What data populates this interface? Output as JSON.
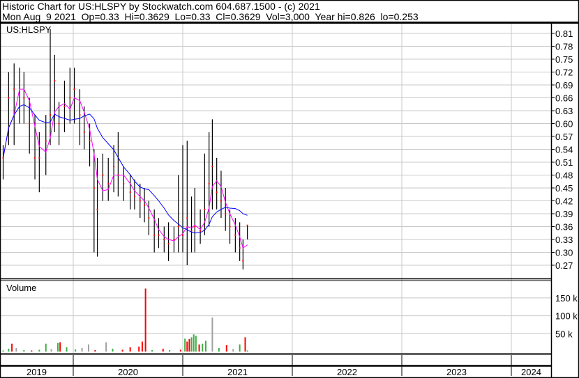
{
  "header": {
    "title": "Historic Chart for US:HLSPY by Stockwatch.com 604.687.1500 - (c) 2021",
    "quote": "Mon Aug  9 2021  Op=0.33  Hi=0.3629  Lo=0.33  Cl=0.3629  Vol=3,000  Year hi=0.826  lo=0.253"
  },
  "colors": {
    "up": "#3cb043",
    "down": "#ff0000",
    "flat": "#a0a0a0",
    "ma_short": "#ff00ff",
    "ma_long": "#0000ff",
    "grid": "#c8c8c8"
  },
  "chart_data": [
    {
      "type": "ohlc",
      "title": "US:HLSPY",
      "x_unit": "year",
      "xlim": [
        2019.33,
        2024.37
      ],
      "ylim": [
        0.245,
        0.83
      ],
      "y_ticks": [
        "0.81",
        "0.78",
        "0.75",
        "0.72",
        "0.69",
        "0.66",
        "0.63",
        "0.60",
        "0.57",
        "0.54",
        "0.51",
        "0.48",
        "0.45",
        "0.42",
        "0.39",
        "0.36",
        "0.33",
        "0.30",
        "0.27"
      ],
      "x_tick_labels": [
        "2019",
        "2020",
        "2021",
        "2022",
        "2023",
        "2024"
      ],
      "moving_averages": [
        "short",
        "long"
      ],
      "points": [
        [
          2019.36,
          0.55,
          0.47,
          0.52
        ],
        [
          2019.41,
          0.72,
          0.55,
          0.66
        ],
        [
          2019.46,
          0.74,
          0.55,
          0.68
        ],
        [
          2019.51,
          0.73,
          0.6,
          0.7
        ],
        [
          2019.55,
          0.72,
          0.6,
          0.66
        ],
        [
          2019.6,
          0.66,
          0.53,
          0.6
        ],
        [
          2019.65,
          0.62,
          0.47,
          0.52
        ],
        [
          2019.69,
          0.58,
          0.44,
          0.52
        ],
        [
          2019.75,
          0.62,
          0.48,
          0.56
        ],
        [
          2019.79,
          0.82,
          0.55,
          0.62
        ],
        [
          2019.83,
          0.76,
          0.58,
          0.7
        ],
        [
          2019.87,
          0.65,
          0.55,
          0.6
        ],
        [
          2019.92,
          0.7,
          0.58,
          0.64
        ],
        [
          2019.97,
          0.73,
          0.6,
          0.66
        ],
        [
          2020.01,
          0.73,
          0.6,
          0.68
        ],
        [
          2020.06,
          0.68,
          0.55,
          0.62
        ],
        [
          2020.1,
          0.64,
          0.54,
          0.58
        ],
        [
          2020.15,
          0.6,
          0.5,
          0.56
        ],
        [
          2020.19,
          0.54,
          0.3,
          0.45
        ],
        [
          2020.22,
          0.52,
          0.29,
          0.4
        ],
        [
          2020.27,
          0.53,
          0.42,
          0.48
        ],
        [
          2020.32,
          0.52,
          0.42,
          0.46
        ],
        [
          2020.37,
          0.55,
          0.44,
          0.5
        ],
        [
          2020.41,
          0.58,
          0.43,
          0.48
        ],
        [
          2020.46,
          0.5,
          0.42,
          0.46
        ],
        [
          2020.52,
          0.48,
          0.4,
          0.44
        ],
        [
          2020.56,
          0.47,
          0.4,
          0.43
        ],
        [
          2020.61,
          0.46,
          0.38,
          0.42
        ],
        [
          2020.65,
          0.45,
          0.37,
          0.41
        ],
        [
          2020.69,
          0.42,
          0.34,
          0.38
        ],
        [
          2020.74,
          0.4,
          0.3,
          0.34
        ],
        [
          2020.78,
          0.38,
          0.31,
          0.34
        ],
        [
          2020.83,
          0.36,
          0.3,
          0.33
        ],
        [
          2020.87,
          0.37,
          0.28,
          0.32
        ],
        [
          2020.92,
          0.36,
          0.3,
          0.33
        ],
        [
          2020.96,
          0.48,
          0.3,
          0.36
        ],
        [
          2021.0,
          0.55,
          0.3,
          0.34
        ],
        [
          2021.04,
          0.56,
          0.27,
          0.38
        ],
        [
          2021.08,
          0.43,
          0.3,
          0.35
        ],
        [
          2021.11,
          0.45,
          0.3,
          0.36
        ],
        [
          2021.16,
          0.4,
          0.32,
          0.35
        ],
        [
          2021.2,
          0.53,
          0.34,
          0.4
        ],
        [
          2021.24,
          0.58,
          0.36,
          0.46
        ],
        [
          2021.27,
          0.61,
          0.4,
          0.5
        ],
        [
          2021.31,
          0.52,
          0.4,
          0.44
        ],
        [
          2021.35,
          0.49,
          0.38,
          0.42
        ],
        [
          2021.39,
          0.45,
          0.35,
          0.39
        ],
        [
          2021.43,
          0.4,
          0.32,
          0.36
        ],
        [
          2021.48,
          0.38,
          0.3,
          0.34
        ],
        [
          2021.52,
          0.37,
          0.28,
          0.31
        ],
        [
          2021.55,
          0.33,
          0.26,
          0.28
        ],
        [
          2021.59,
          0.3629,
          0.33,
          0.3629
        ]
      ]
    },
    {
      "type": "bar",
      "title": "Volume",
      "y_unit": "k shares",
      "ylim": [
        0,
        200
      ],
      "y_ticks": [
        "150 k",
        "100 k",
        "50 k"
      ],
      "bars": [
        [
          2019.36,
          3,
          "up"
        ],
        [
          2019.41,
          8,
          "up"
        ],
        [
          2019.44,
          22,
          "down"
        ],
        [
          2019.48,
          10,
          "flat"
        ],
        [
          2019.55,
          4,
          "up"
        ],
        [
          2019.62,
          3,
          "down"
        ],
        [
          2019.69,
          5,
          "up"
        ],
        [
          2019.75,
          22,
          "up"
        ],
        [
          2019.8,
          7,
          "flat"
        ],
        [
          2019.86,
          24,
          "up"
        ],
        [
          2019.88,
          26,
          "down"
        ],
        [
          2019.94,
          12,
          "up"
        ],
        [
          2020.02,
          6,
          "up"
        ],
        [
          2020.08,
          10,
          "flat"
        ],
        [
          2020.14,
          20,
          "flat"
        ],
        [
          2020.2,
          4,
          "down"
        ],
        [
          2020.3,
          26,
          "flat"
        ],
        [
          2020.36,
          8,
          "up"
        ],
        [
          2020.45,
          5,
          "down"
        ],
        [
          2020.52,
          12,
          "down"
        ],
        [
          2020.6,
          14,
          "down"
        ],
        [
          2020.63,
          28,
          "down"
        ],
        [
          2020.66,
          176,
          "down"
        ],
        [
          2020.72,
          4,
          "up"
        ],
        [
          2020.82,
          8,
          "down"
        ],
        [
          2020.88,
          4,
          "up"
        ],
        [
          2020.98,
          5,
          "down"
        ],
        [
          2021.02,
          36,
          "up"
        ],
        [
          2021.04,
          28,
          "down"
        ],
        [
          2021.06,
          35,
          "down"
        ],
        [
          2021.08,
          40,
          "up"
        ],
        [
          2021.1,
          48,
          "up"
        ],
        [
          2021.12,
          44,
          "up"
        ],
        [
          2021.15,
          20,
          "down"
        ],
        [
          2021.18,
          22,
          "up"
        ],
        [
          2021.21,
          30,
          "up"
        ],
        [
          2021.27,
          95,
          "flat"
        ],
        [
          2021.33,
          10,
          "up"
        ],
        [
          2021.4,
          18,
          "down"
        ],
        [
          2021.46,
          7,
          "flat"
        ],
        [
          2021.52,
          20,
          "up"
        ],
        [
          2021.57,
          40,
          "down"
        ],
        [
          2021.59,
          3,
          "up"
        ]
      ]
    }
  ]
}
